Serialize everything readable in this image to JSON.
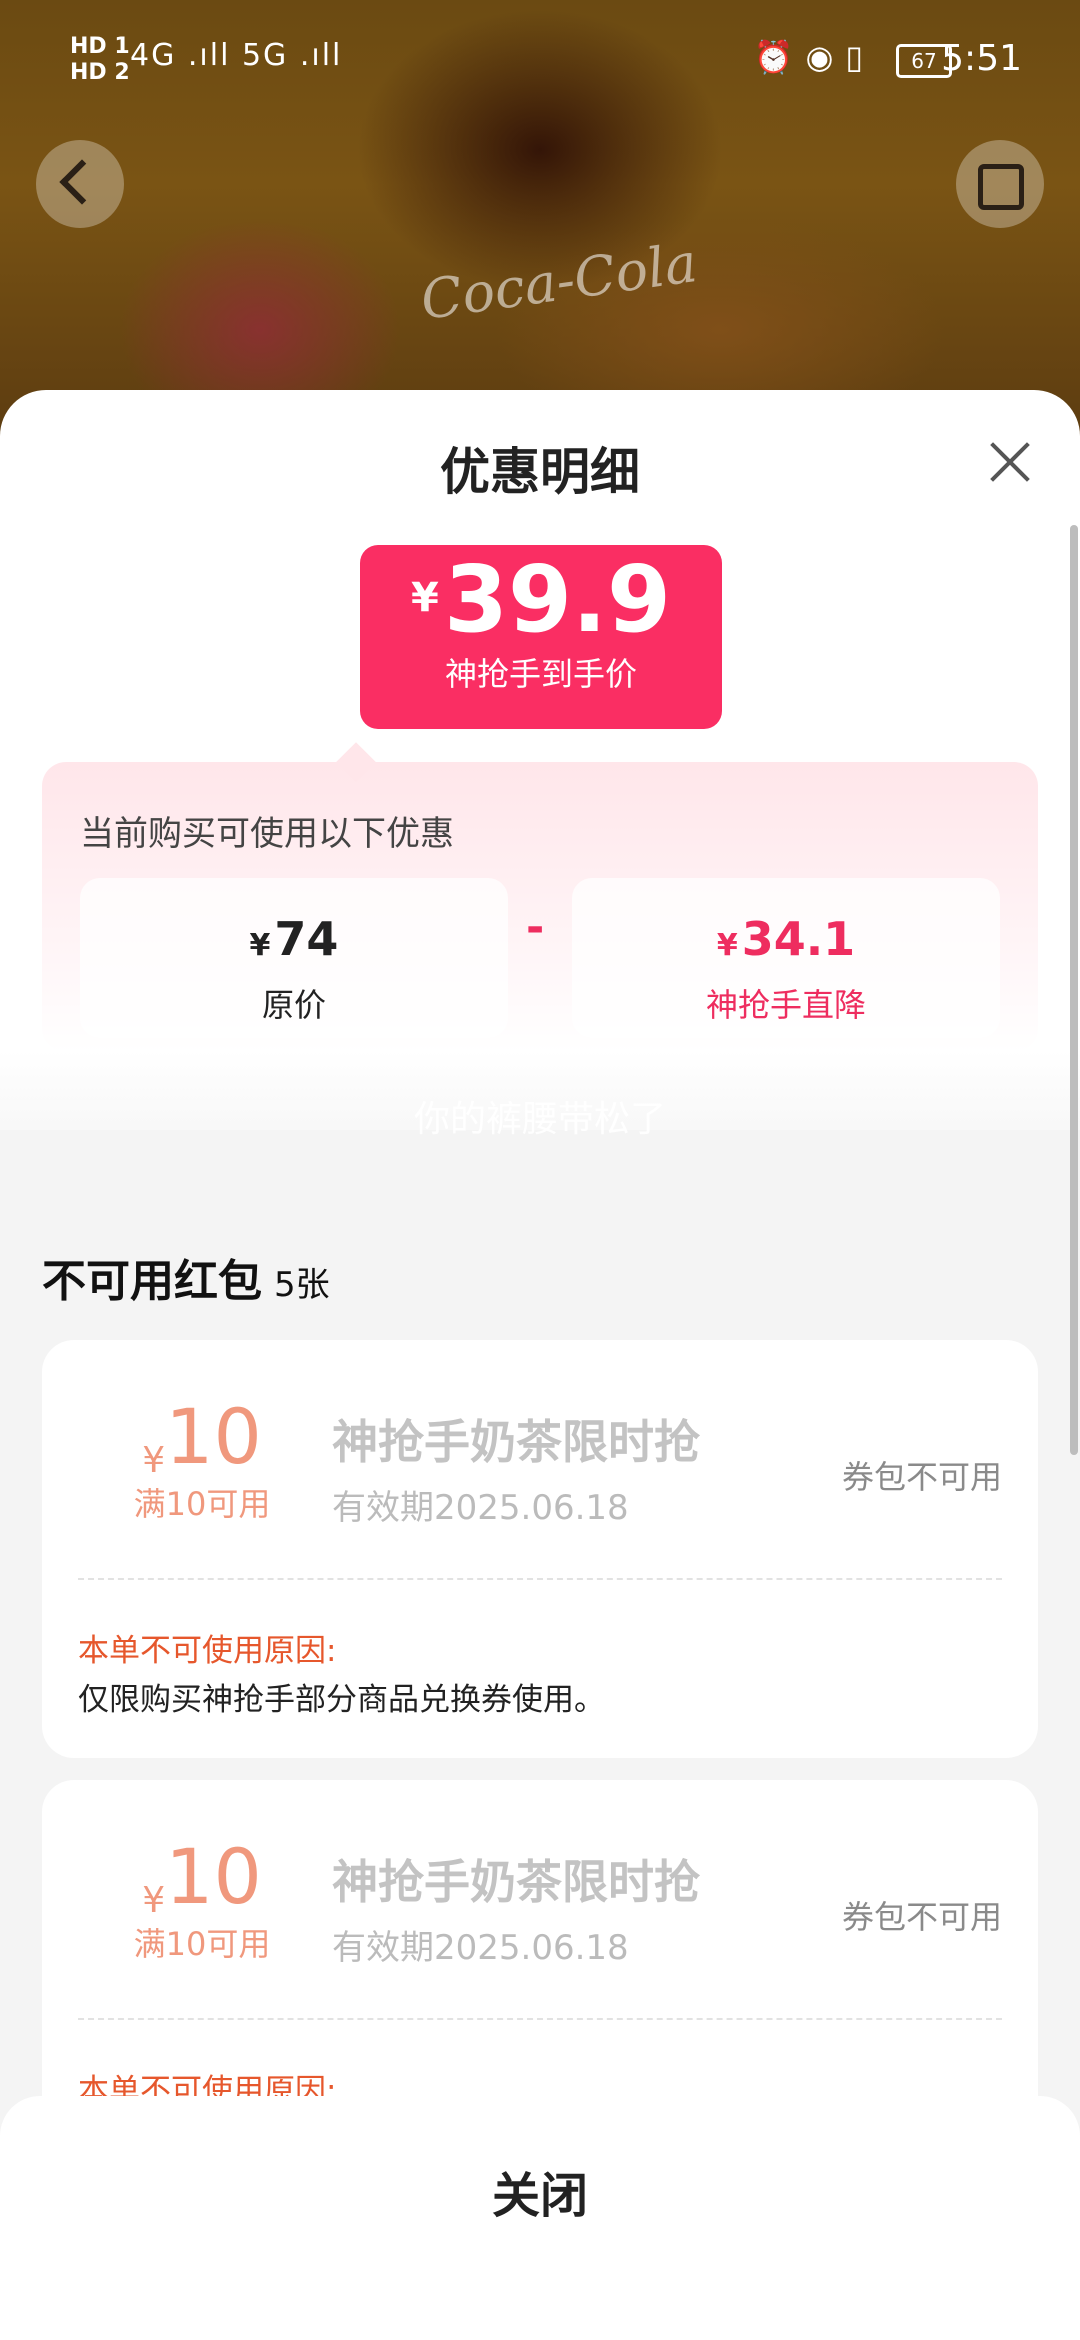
{
  "status_bar": {
    "hd1": "HD 1",
    "hd2": "HD 2",
    "signal": "4G .ıll  5G .ıll",
    "battery": "67",
    "time": "5:51"
  },
  "hero": {
    "brand_text": "Coca-Cola"
  },
  "sheet": {
    "title": "优惠明细",
    "badge": {
      "currency": "¥",
      "amount": "39.9",
      "label": "神抢手到手价"
    },
    "promo": {
      "heading": "当前购买可使用以下优惠",
      "original": {
        "currency": "¥",
        "value": "74",
        "label": "原价"
      },
      "minus": "-",
      "discount": {
        "currency": "¥",
        "value": "34.1",
        "label": "神抢手直降"
      }
    },
    "watermark": "你的裤腰带松了",
    "section": {
      "title": "不可用红包",
      "count": "5张"
    },
    "coupons": [
      {
        "currency": "¥",
        "amount": "10",
        "condition": "满10可用",
        "name": "神抢手奶茶限时抢",
        "expiry": "有效期2025.06.18",
        "state": "券包不可用",
        "reason_title": "本单不可使用原因:",
        "reason": "仅限购买神抢手部分商品兑换券使用。"
      },
      {
        "currency": "¥",
        "amount": "10",
        "condition": "满10可用",
        "name": "神抢手奶茶限时抢",
        "expiry": "有效期2025.06.18",
        "state": "券包不可用",
        "reason_title": "本单不可使用原因:",
        "reason": ""
      }
    ],
    "close_button": "关闭"
  }
}
